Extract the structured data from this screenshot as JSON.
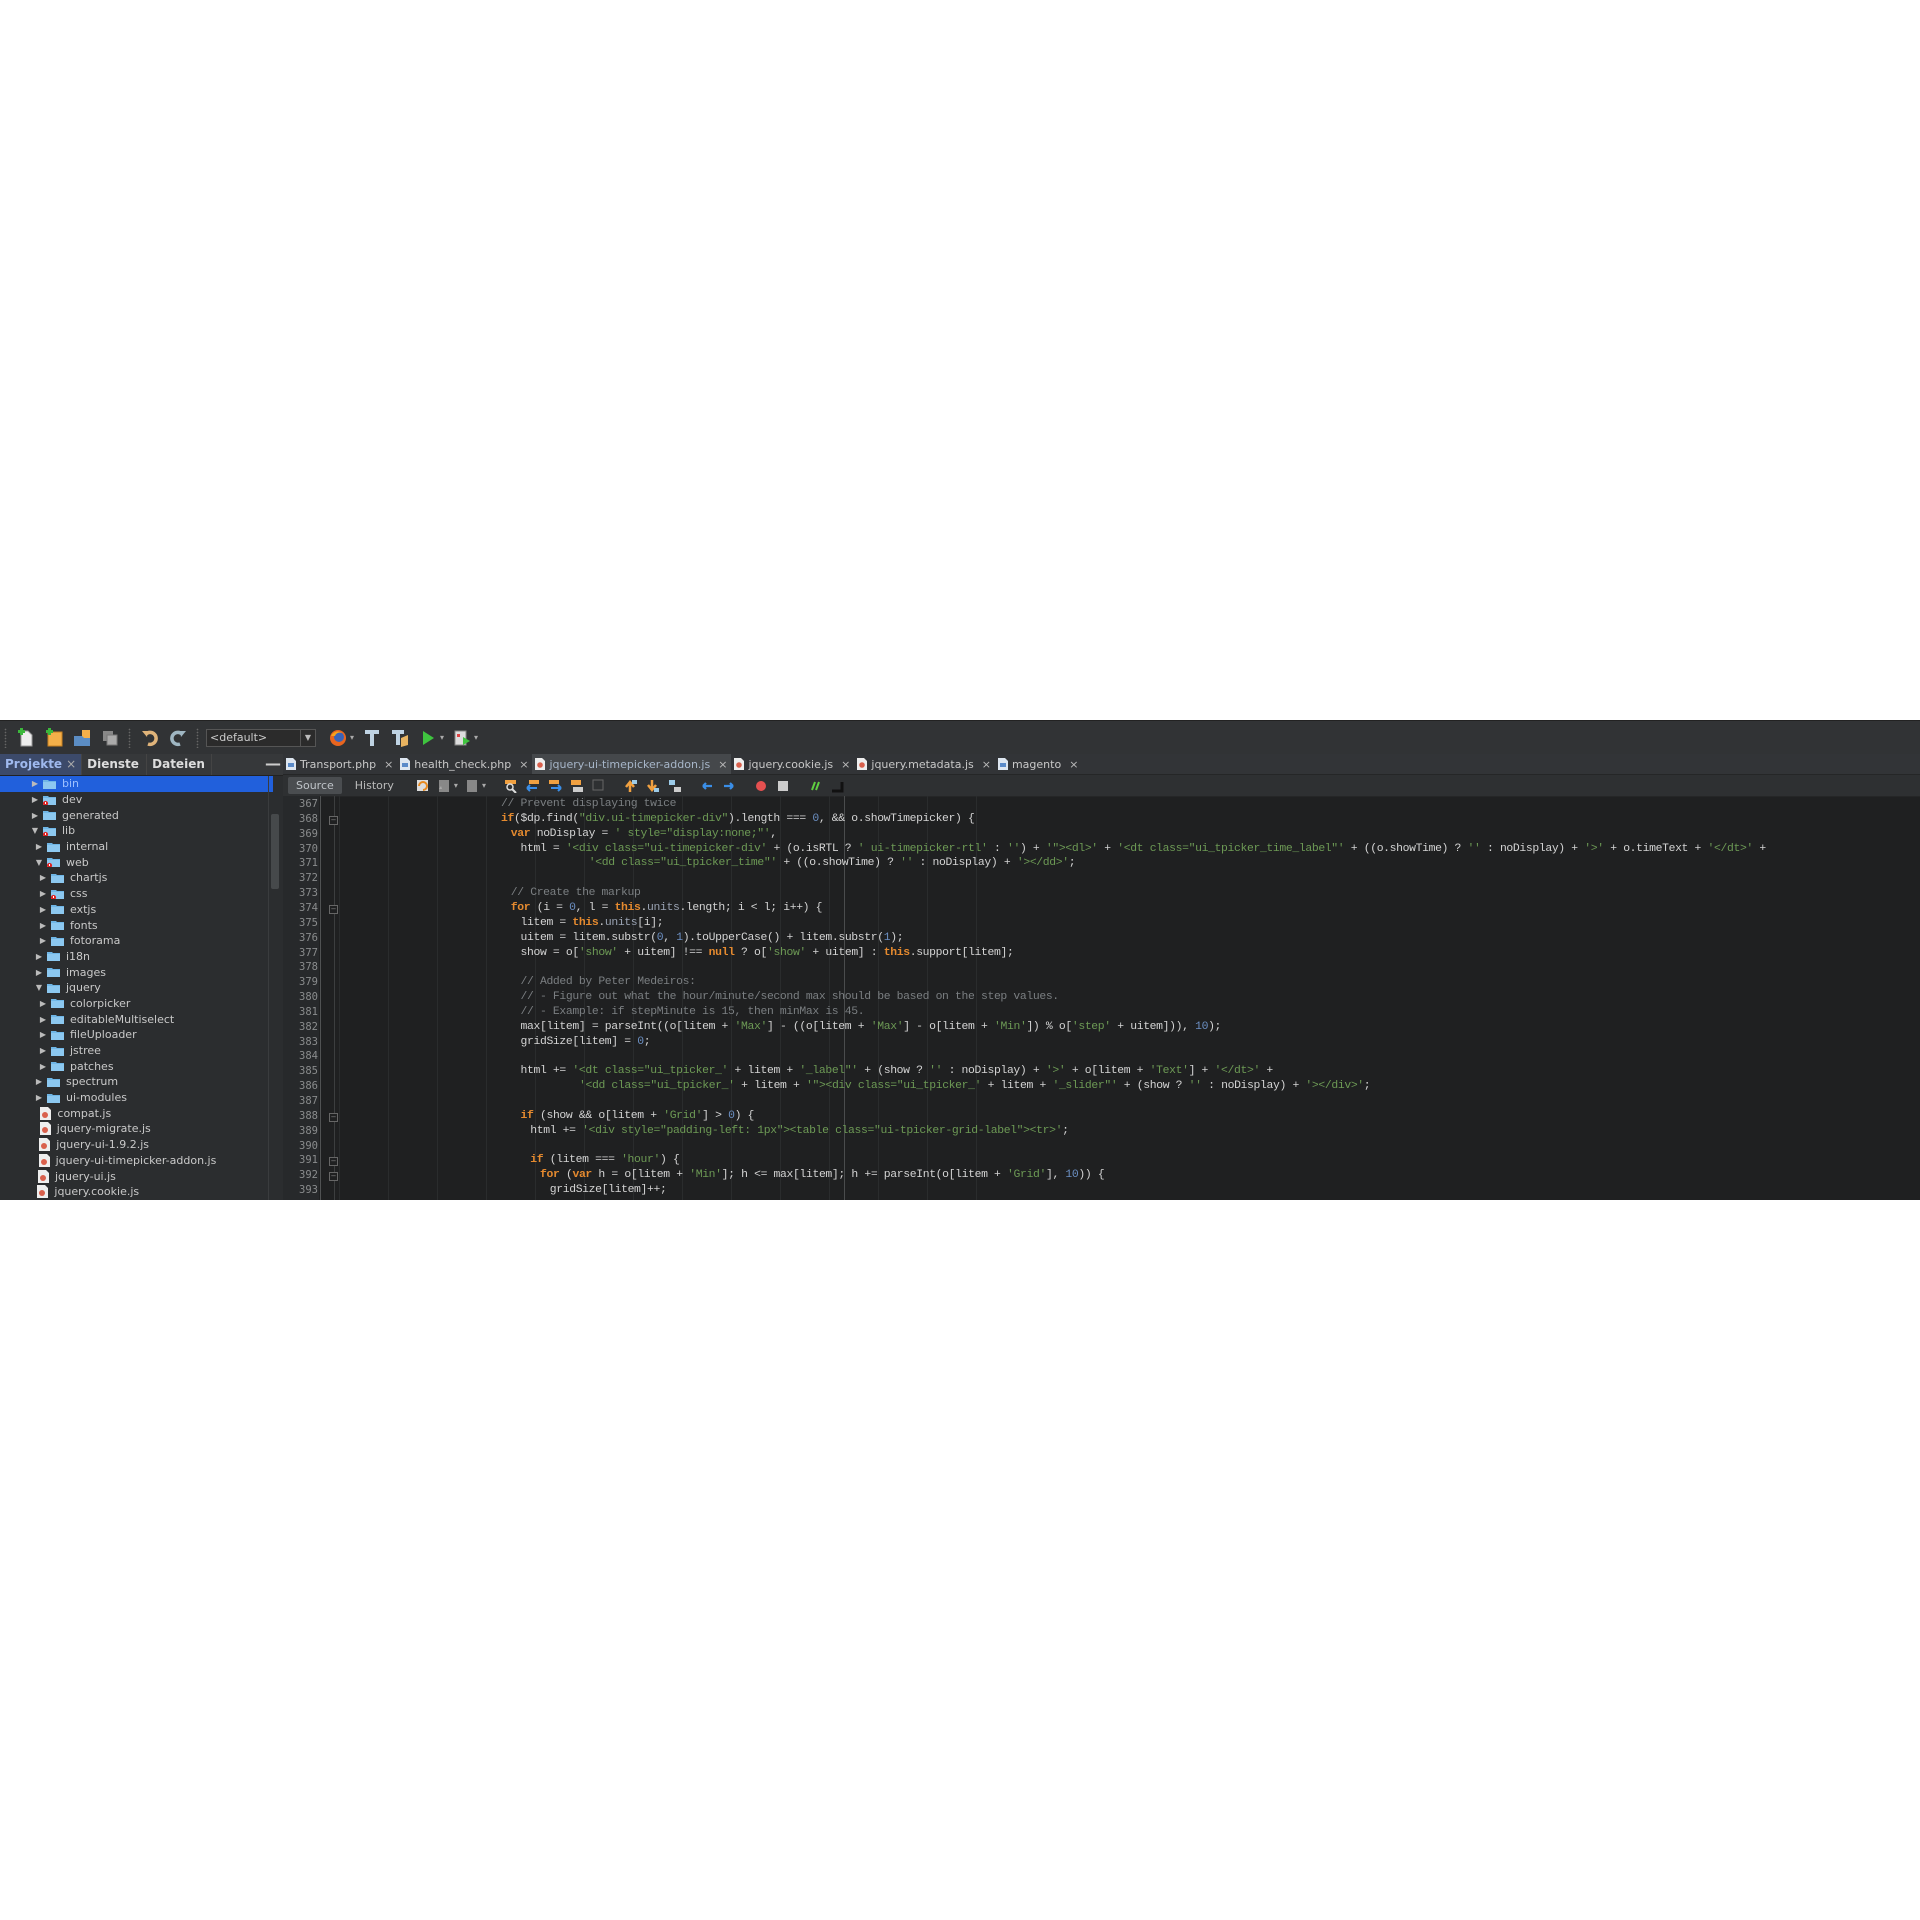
{
  "toolbar": {
    "icons": [
      "new-file-icon",
      "new-project-icon",
      "open-project-icon",
      "close-project-icon",
      "undo-icon",
      "redo-icon",
      "firefox-icon",
      "build-icon",
      "clean-build-icon",
      "run-icon",
      "debug-icon"
    ],
    "config_value": "<default>"
  },
  "left_panel": {
    "tabs": [
      {
        "label": "Projekte",
        "active": true,
        "closable": true
      },
      {
        "label": "Dienste",
        "active": false
      },
      {
        "label": "Dateien",
        "active": false
      }
    ],
    "minimize_label": "—",
    "tree": [
      {
        "label": "bin",
        "type": "folder",
        "expanded": false,
        "depth": 0,
        "selected": true,
        "error": false
      },
      {
        "label": "dev",
        "type": "folder",
        "expanded": false,
        "depth": 0,
        "error": true
      },
      {
        "label": "generated",
        "type": "folder",
        "expanded": false,
        "depth": 0,
        "error": false
      },
      {
        "label": "lib",
        "type": "folder",
        "expanded": true,
        "depth": 0,
        "error": true
      },
      {
        "label": "internal",
        "type": "folder",
        "expanded": false,
        "depth": 1,
        "error": false
      },
      {
        "label": "web",
        "type": "folder",
        "expanded": true,
        "depth": 1,
        "error": true
      },
      {
        "label": "chartjs",
        "type": "folder",
        "expanded": false,
        "depth": 2,
        "error": false
      },
      {
        "label": "css",
        "type": "folder",
        "expanded": false,
        "depth": 2,
        "error": true
      },
      {
        "label": "extjs",
        "type": "folder",
        "expanded": false,
        "depth": 2,
        "error": false
      },
      {
        "label": "fonts",
        "type": "folder",
        "expanded": false,
        "depth": 2,
        "error": false
      },
      {
        "label": "fotorama",
        "type": "folder",
        "expanded": false,
        "depth": 2,
        "error": false
      },
      {
        "label": "i18n",
        "type": "folder",
        "expanded": false,
        "depth": 1,
        "error": false
      },
      {
        "label": "images",
        "type": "folder",
        "expanded": false,
        "depth": 1,
        "error": false
      },
      {
        "label": "jquery",
        "type": "folder",
        "expanded": true,
        "depth": 1,
        "error": false
      },
      {
        "label": "colorpicker",
        "type": "folder",
        "expanded": false,
        "depth": 2,
        "error": false
      },
      {
        "label": "editableMultiselect",
        "type": "folder",
        "expanded": false,
        "depth": 2,
        "error": false
      },
      {
        "label": "fileUploader",
        "type": "folder",
        "expanded": false,
        "depth": 2,
        "error": false
      },
      {
        "label": "jstree",
        "type": "folder",
        "expanded": false,
        "depth": 2,
        "error": false
      },
      {
        "label": "patches",
        "type": "folder",
        "expanded": false,
        "depth": 2,
        "error": false
      },
      {
        "label": "spectrum",
        "type": "folder",
        "expanded": false,
        "depth": 1,
        "error": false
      },
      {
        "label": "ui-modules",
        "type": "folder",
        "expanded": false,
        "depth": 1,
        "error": false
      },
      {
        "label": "compat.js",
        "type": "file",
        "depth": 1
      },
      {
        "label": "jquery-migrate.js",
        "type": "file",
        "depth": 1
      },
      {
        "label": "jquery-ui-1.9.2.js",
        "type": "file",
        "depth": 1
      },
      {
        "label": "jquery-ui-timepicker-addon.js",
        "type": "file",
        "depth": 1
      },
      {
        "label": "jquery-ui.js",
        "type": "file",
        "depth": 1
      },
      {
        "label": "jquery.cookie.js",
        "type": "file",
        "depth": 1
      }
    ]
  },
  "editor": {
    "tabs": [
      {
        "label": "Transport.php",
        "type": "php",
        "active": false
      },
      {
        "label": "health_check.php",
        "type": "php",
        "active": false
      },
      {
        "label": "jquery-ui-timepicker-addon.js",
        "type": "js",
        "active": true
      },
      {
        "label": "jquery.cookie.js",
        "type": "js",
        "active": false
      },
      {
        "label": "jquery.metadata.js",
        "type": "js",
        "active": false
      },
      {
        "label": "magento",
        "type": "php",
        "active": false
      }
    ],
    "view_buttons": [
      {
        "label": "Source",
        "active": true
      },
      {
        "label": "History",
        "active": false
      }
    ],
    "toolbar_icons": [
      "last-edit-icon",
      "back-icon",
      "forward-icon",
      "find-selection-icon",
      "find-previous-icon",
      "find-next-icon",
      "toggle-highlight-icon",
      "toggle-rect-selection-icon",
      "previous-bookmark-icon",
      "next-bookmark-icon",
      "toggle-bookmark-icon",
      "shift-left-icon",
      "shift-right-icon",
      "start-macro-icon",
      "stop-macro-icon",
      "comment-icon",
      "uncomment-icon"
    ],
    "lines": [
      {
        "n": 367,
        "indent": 8,
        "fold": false,
        "tokens": [
          [
            "cm",
            "// Prevent displaying twice"
          ]
        ]
      },
      {
        "n": 368,
        "indent": 8,
        "fold": true,
        "tokens": [
          [
            "kw",
            "if"
          ],
          [
            "",
            "($dp.find("
          ],
          [
            "str",
            "\"div.ui-timepicker-div\""
          ],
          [
            "",
            ").length === "
          ],
          [
            "num",
            "0"
          ],
          [
            "",
            ", && o.showTimepicker) {"
          ]
        ]
      },
      {
        "n": 369,
        "indent": 10,
        "fold": false,
        "tokens": [
          [
            "kw",
            "var"
          ],
          [
            "",
            " noDisplay = "
          ],
          [
            "str",
            "' style=\"display:none;\"'"
          ],
          [
            "",
            ","
          ]
        ]
      },
      {
        "n": 370,
        "indent": 12,
        "fold": false,
        "tokens": [
          [
            "",
            "html = "
          ],
          [
            "str",
            "'<div class=\"ui-timepicker-div'"
          ],
          [
            "",
            " + (o.isRTL ? "
          ],
          [
            "str",
            "' ui-timepicker-rtl'"
          ],
          [
            "",
            " : "
          ],
          [
            "str",
            "''"
          ],
          [
            "",
            ") + "
          ],
          [
            "str",
            "'\"><dl>'"
          ],
          [
            "",
            " + "
          ],
          [
            "str",
            "'<dt class=\"ui_tpicker_time_label\"'"
          ],
          [
            "",
            " + ((o.showTime) ? "
          ],
          [
            "str",
            "''"
          ],
          [
            "",
            " : noDisplay) + "
          ],
          [
            "str",
            "'>'"
          ],
          [
            "",
            " + o.timeText + "
          ],
          [
            "str",
            "'</dt>'"
          ],
          [
            "",
            " +"
          ]
        ]
      },
      {
        "n": 371,
        "indent": 26,
        "fold": false,
        "tokens": [
          [
            "str",
            "'<dd class=\"ui_tpicker_time\"'"
          ],
          [
            "",
            " + ((o.showTime) ? "
          ],
          [
            "str",
            "''"
          ],
          [
            "",
            " : noDisplay) + "
          ],
          [
            "str",
            "'></dd>'"
          ],
          [
            "",
            ";"
          ]
        ]
      },
      {
        "n": 372,
        "indent": 0,
        "fold": false,
        "tokens": []
      },
      {
        "n": 373,
        "indent": 10,
        "fold": false,
        "tokens": [
          [
            "cm",
            "// Create the markup"
          ]
        ]
      },
      {
        "n": 374,
        "indent": 10,
        "fold": true,
        "tokens": [
          [
            "kw",
            "for"
          ],
          [
            "",
            " (i = "
          ],
          [
            "num",
            "0"
          ],
          [
            "",
            ", l = "
          ],
          [
            "kw",
            "this"
          ],
          [
            "",
            "."
          ],
          [
            "prop",
            "units"
          ],
          [
            "",
            ".length; i < l; i++) {"
          ]
        ]
      },
      {
        "n": 375,
        "indent": 12,
        "fold": false,
        "tokens": [
          [
            "",
            "litem = "
          ],
          [
            "kw",
            "this"
          ],
          [
            "",
            "."
          ],
          [
            "prop",
            "units"
          ],
          [
            "",
            "[i];"
          ]
        ]
      },
      {
        "n": 376,
        "indent": 12,
        "fold": false,
        "tokens": [
          [
            "",
            "uitem = litem.substr("
          ],
          [
            "num",
            "0"
          ],
          [
            "",
            ", "
          ],
          [
            "num",
            "1"
          ],
          [
            "",
            ").toUpperCase() + litem.substr("
          ],
          [
            "num",
            "1"
          ],
          [
            "",
            ");"
          ]
        ]
      },
      {
        "n": 377,
        "indent": 12,
        "fold": false,
        "tokens": [
          [
            "",
            "show = o["
          ],
          [
            "str",
            "'show'"
          ],
          [
            "",
            " + uitem] !== "
          ],
          [
            "kw",
            "null"
          ],
          [
            "",
            " ? o["
          ],
          [
            "str",
            "'show'"
          ],
          [
            "",
            " + uitem] : "
          ],
          [
            "kw",
            "this"
          ],
          [
            "",
            ".support[litem];"
          ]
        ]
      },
      {
        "n": 378,
        "indent": 0,
        "fold": false,
        "tokens": []
      },
      {
        "n": 379,
        "indent": 12,
        "fold": false,
        "tokens": [
          [
            "cm",
            "// Added by Peter Medeiros:"
          ]
        ]
      },
      {
        "n": 380,
        "indent": 12,
        "fold": false,
        "tokens": [
          [
            "cm",
            "// - Figure out what the hour/minute/second max should be based on the step values."
          ]
        ]
      },
      {
        "n": 381,
        "indent": 12,
        "fold": false,
        "tokens": [
          [
            "cm",
            "// - Example: if stepMinute is 15, then minMax is 45."
          ]
        ]
      },
      {
        "n": 382,
        "indent": 12,
        "fold": false,
        "tokens": [
          [
            "",
            "max[litem] = parseInt((o[litem + "
          ],
          [
            "str",
            "'Max'"
          ],
          [
            "",
            "] - ((o[litem + "
          ],
          [
            "str",
            "'Max'"
          ],
          [
            "",
            "] - o[litem + "
          ],
          [
            "str",
            "'Min'"
          ],
          [
            "",
            "]) % o["
          ],
          [
            "str",
            "'step'"
          ],
          [
            "",
            " + uitem])), "
          ],
          [
            "num",
            "10"
          ],
          [
            "",
            ");"
          ]
        ]
      },
      {
        "n": 383,
        "indent": 12,
        "fold": false,
        "tokens": [
          [
            "",
            "gridSize[litem] = "
          ],
          [
            "num",
            "0"
          ],
          [
            "",
            ";"
          ]
        ]
      },
      {
        "n": 384,
        "indent": 0,
        "fold": false,
        "tokens": []
      },
      {
        "n": 385,
        "indent": 12,
        "fold": false,
        "tokens": [
          [
            "",
            "html += "
          ],
          [
            "str",
            "'<dt class=\"ui_tpicker_'"
          ],
          [
            "",
            " + litem + "
          ],
          [
            "str",
            "'_label\"'"
          ],
          [
            "",
            " + (show ? "
          ],
          [
            "str",
            "''"
          ],
          [
            "",
            " : noDisplay) + "
          ],
          [
            "str",
            "'>'"
          ],
          [
            "",
            " + o[litem + "
          ],
          [
            "str",
            "'Text'"
          ],
          [
            "",
            "] + "
          ],
          [
            "str",
            "'</dt>'"
          ],
          [
            "",
            " +"
          ]
        ]
      },
      {
        "n": 386,
        "indent": 24,
        "fold": false,
        "tokens": [
          [
            "str",
            "'<dd class=\"ui_tpicker_'"
          ],
          [
            "",
            " + litem + "
          ],
          [
            "str",
            "'\"><div class=\"ui_tpicker_'"
          ],
          [
            "",
            " + litem + "
          ],
          [
            "str",
            "'_slider\"'"
          ],
          [
            "",
            " + (show ? "
          ],
          [
            "str",
            "''"
          ],
          [
            "",
            " : noDisplay) + "
          ],
          [
            "str",
            "'></div>'"
          ],
          [
            "",
            ";"
          ]
        ]
      },
      {
        "n": 387,
        "indent": 0,
        "fold": false,
        "tokens": []
      },
      {
        "n": 388,
        "indent": 12,
        "fold": true,
        "tokens": [
          [
            "kw",
            "if"
          ],
          [
            "",
            " (show && o[litem + "
          ],
          [
            "str",
            "'Grid'"
          ],
          [
            "",
            "] > "
          ],
          [
            "num",
            "0"
          ],
          [
            "",
            ") {"
          ]
        ]
      },
      {
        "n": 389,
        "indent": 14,
        "fold": false,
        "tokens": [
          [
            "",
            "html += "
          ],
          [
            "str",
            "'<div style=\"padding-left: 1px\"><table class=\"ui-tpicker-grid-label\"><tr>'"
          ],
          [
            "",
            ";"
          ]
        ]
      },
      {
        "n": 390,
        "indent": 0,
        "fold": false,
        "tokens": []
      },
      {
        "n": 391,
        "indent": 14,
        "fold": true,
        "tokens": [
          [
            "kw",
            "if"
          ],
          [
            "",
            " (litem === "
          ],
          [
            "str",
            "'hour'"
          ],
          [
            "",
            ") {"
          ]
        ]
      },
      {
        "n": 392,
        "indent": 16,
        "fold": true,
        "tokens": [
          [
            "kw",
            "for"
          ],
          [
            "",
            " ("
          ],
          [
            "kw",
            "var"
          ],
          [
            "",
            " h = o[litem + "
          ],
          [
            "str",
            "'Min'"
          ],
          [
            "",
            "]; h <= max[litem]; h += parseInt(o[litem + "
          ],
          [
            "str",
            "'Grid'"
          ],
          [
            "",
            "], "
          ],
          [
            "num",
            "10"
          ],
          [
            "",
            ")) {"
          ]
        ]
      },
      {
        "n": 393,
        "indent": 18,
        "fold": false,
        "tokens": [
          [
            "",
            "gridSize[litem]++;"
          ]
        ]
      }
    ]
  },
  "colors": {
    "selection": "#2160dc",
    "keyword": "#e58a2f",
    "string": "#6d9a55",
    "number": "#6b8fc2",
    "comment": "#7b7f82",
    "editor_bg": "#1f2021"
  }
}
